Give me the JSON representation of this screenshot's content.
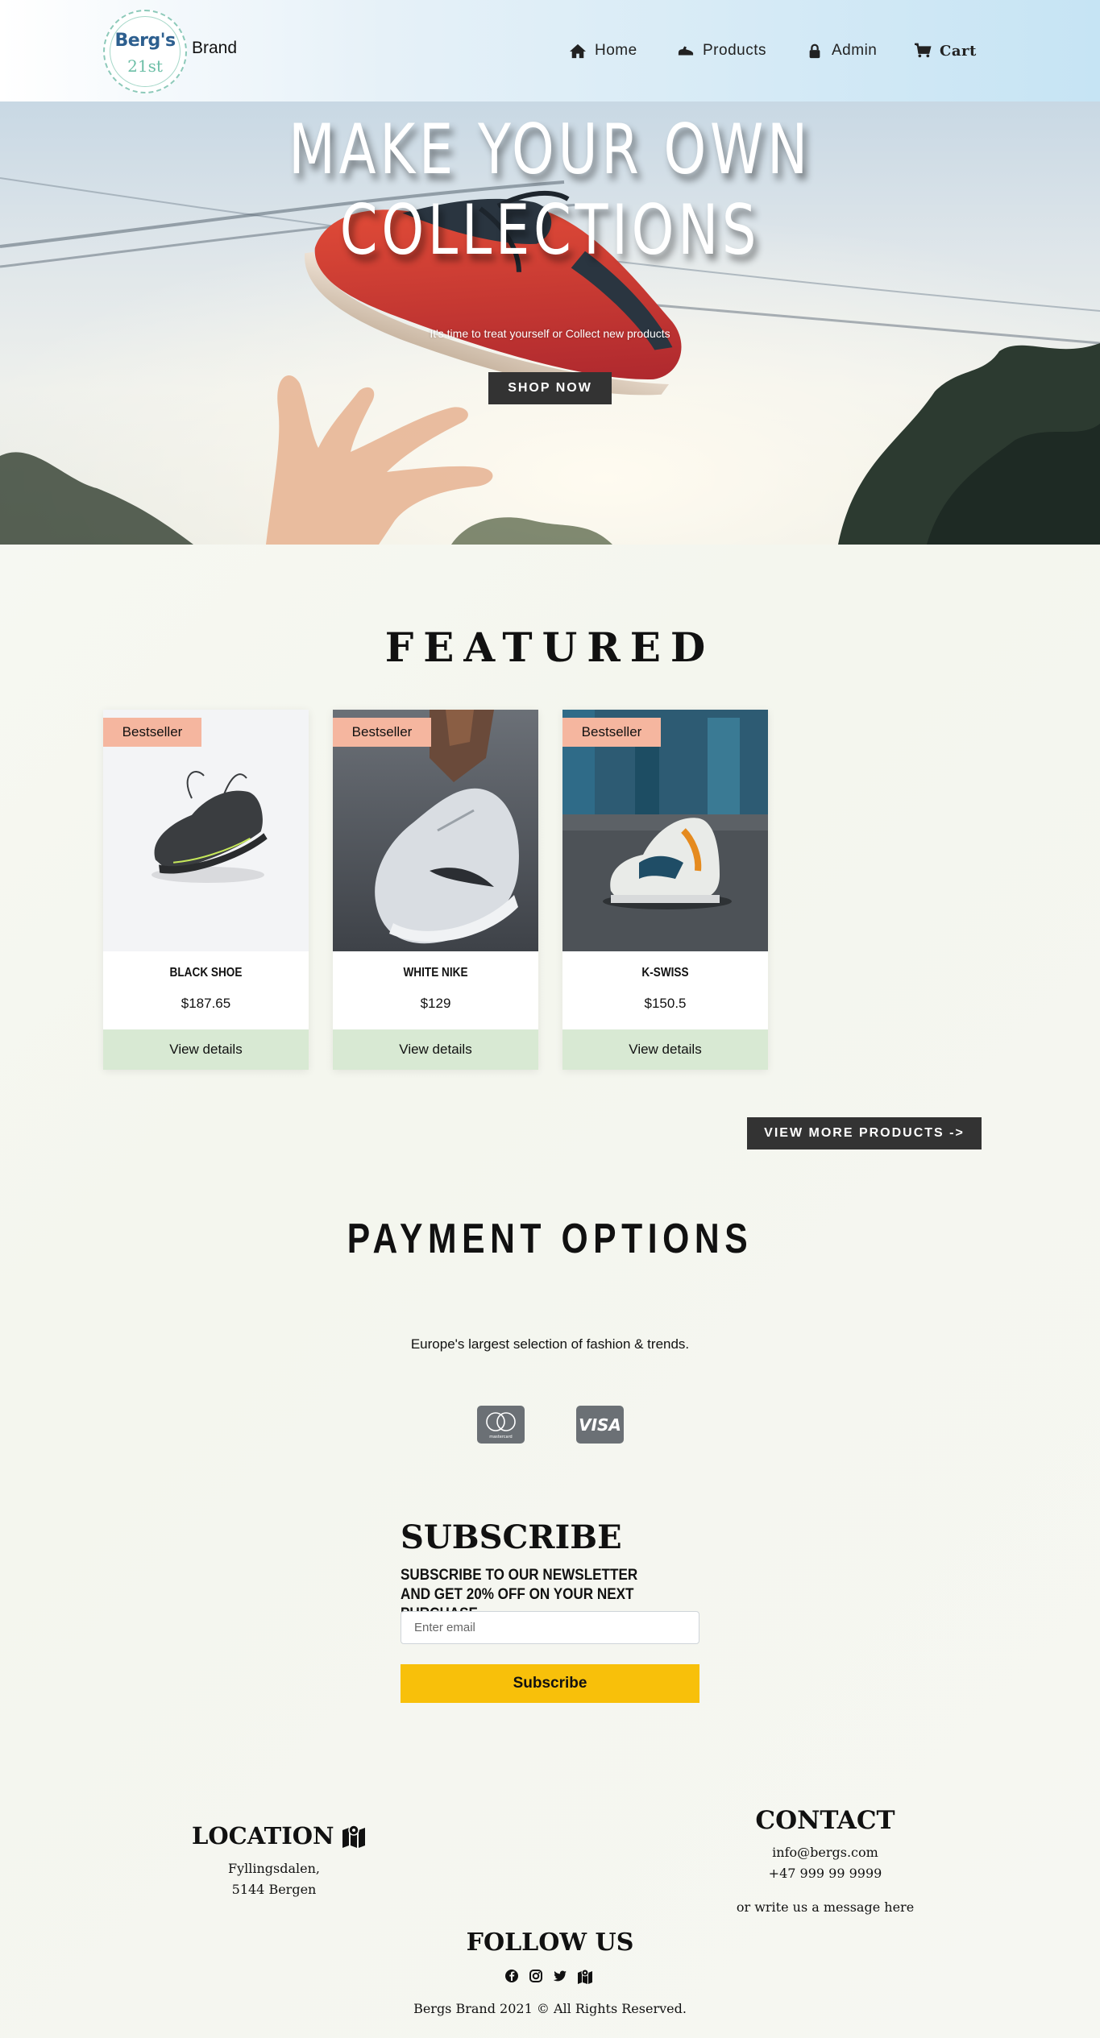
{
  "brand": {
    "logo_main": "Berg's",
    "logo_sub": "21st",
    "name": "Brand"
  },
  "nav": {
    "home": "Home",
    "products": "Products",
    "admin": "Admin",
    "cart": "Cart"
  },
  "hero": {
    "title_line1": "MAKE YOUR OWN",
    "title_line2": "COLLECTIONS",
    "subtitle": "It's time to treat yourself or Collect new products",
    "button": "SHOP NOW"
  },
  "featured": {
    "title": "FEATURED",
    "products": [
      {
        "badge": "Bestseller",
        "name": "BLACK SHOE",
        "price": "$187.65",
        "action": "View details"
      },
      {
        "badge": "Bestseller",
        "name": "WHITE NIKE",
        "price": "$129",
        "action": "View details"
      },
      {
        "badge": "Bestseller",
        "name": "K-SWISS",
        "price": "$150.5",
        "action": "View details"
      }
    ],
    "more_button": "VIEW MORE PRODUCTS ->"
  },
  "payment": {
    "title": "PAYMENT OPTIONS",
    "description": "Europe's largest selection of fashion & trends.",
    "icons": [
      "mastercard-icon",
      "visa-icon"
    ],
    "mastercard_label": "mastercard",
    "visa_label": "VISA"
  },
  "subscribe": {
    "title": "SUBSCRIBE",
    "text": "SUBSCRIBE TO OUR NEWSLETTER AND GET 20% OFF ON YOUR NEXT PURCHASE.",
    "placeholder": "Enter email",
    "button": "Subscribe"
  },
  "footer": {
    "location_title": "LOCATION",
    "address_line1": "Fyllingsdalen,",
    "address_line2": "5144 Bergen",
    "contact_title": "CONTACT",
    "email": "info@bergs.com",
    "phone": "+47 999 99 9999",
    "message": "or write us a message here",
    "follow_title": "FOLLOW US",
    "social_icons": [
      "facebook-icon",
      "instagram-icon",
      "twitter-icon",
      "map-icon"
    ],
    "copyright": "Bergs Brand 2021 © All Rights Reserved."
  },
  "colors": {
    "badge": "#f5b69f",
    "details_bg": "#d8e9d3",
    "dark_button": "#333333",
    "subscribe_button": "#f8c00a",
    "nav_gradient_end": "#c6e4f4"
  }
}
